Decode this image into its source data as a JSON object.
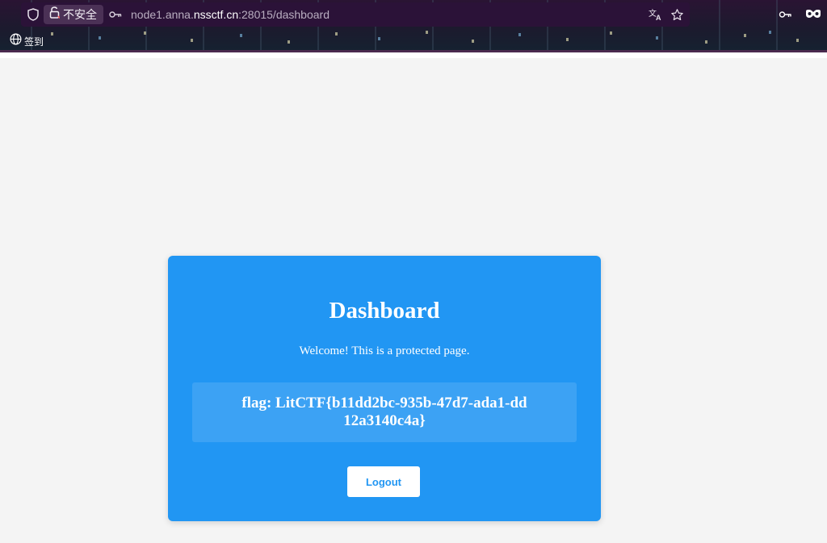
{
  "browser": {
    "security_label": "不安全",
    "url_prefix": "node1.anna.",
    "url_domain": "nssctf.cn",
    "url_suffix": ":28015/dashboard",
    "bookmark_label": "签到"
  },
  "card": {
    "title": "Dashboard",
    "welcome": "Welcome! This is a protected page.",
    "flag": "flag: LitCTF{b11dd2bc-935b-47d7-ada1-dd12a3140c4a}",
    "logout_label": "Logout",
    "background_color": "#2196f3"
  },
  "icons": {
    "shield": "shield-icon",
    "insecure": "broken-lock-icon",
    "key": "key-icon",
    "translate": "translate-icon",
    "star": "bookmark-star-icon",
    "mask": "private-mask-icon",
    "globe": "globe-icon"
  }
}
